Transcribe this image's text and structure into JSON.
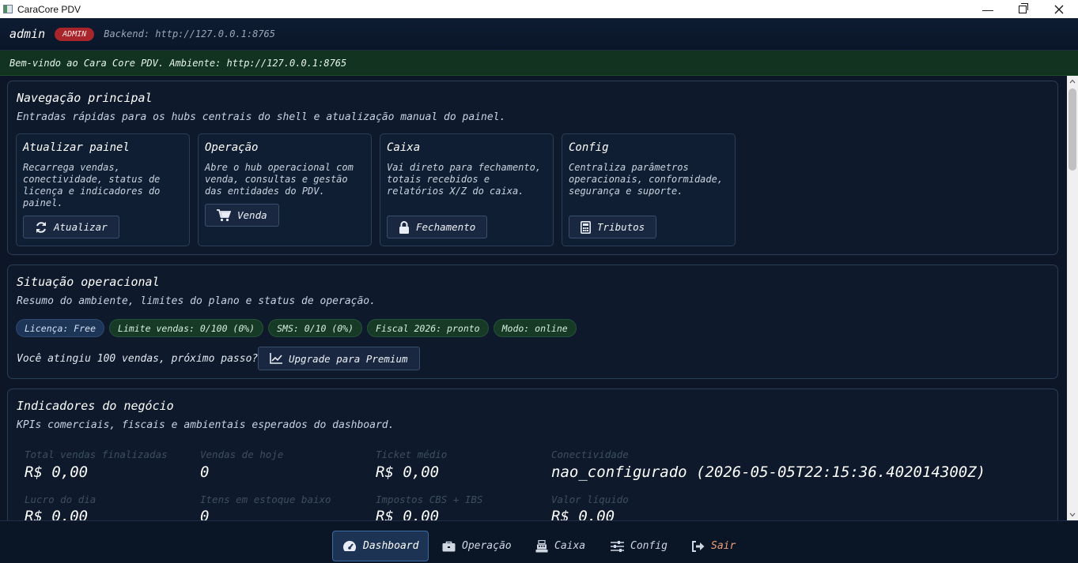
{
  "window": {
    "title": "CaraCore PDV",
    "minimize": "—"
  },
  "header": {
    "user": "admin",
    "role": "ADMIN",
    "backend": "Backend: http://127.0.0.1:8765"
  },
  "banner": "Bem-vindo ao Cara Core PDV. Ambiente: http://127.0.0.1:8765",
  "nav_section": {
    "title": "Navegação principal",
    "subtitle": "Entradas rápidas para os hubs centrais do shell e atualização manual do painel.",
    "hubs": [
      {
        "title": "Atualizar painel",
        "desc": "Recarrega vendas, conectividade, status de licença e indicadores do painel.",
        "button": "Atualizar",
        "icon": "refresh-icon"
      },
      {
        "title": "Operação",
        "desc": "Abre o hub operacional com venda, consultas e gestão das entidades do PDV.",
        "button": "Venda",
        "icon": "cart-icon"
      },
      {
        "title": "Caixa",
        "desc": "Vai direto para fechamento, totais recebidos e relatórios X/Z do caixa.",
        "button": "Fechamento",
        "icon": "lock-icon"
      },
      {
        "title": "Config",
        "desc": "Centraliza parâmetros operacionais, conformidade, segurança e suporte.",
        "button": "Tributos",
        "icon": "calculator-icon"
      }
    ]
  },
  "status_section": {
    "title": "Situação operacional",
    "subtitle": "Resumo do ambiente, limites do plano e status de operação.",
    "chips": [
      "Licença: Free",
      "Limite vendas: 0/100 (0%)",
      "SMS: 0/10 (0%)",
      "Fiscal 2026: pronto",
      "Modo: online"
    ],
    "upgrade_prompt": "Você atingiu 100 vendas, próximo passo?",
    "upgrade_button": "Upgrade para Premium"
  },
  "kpi_section": {
    "title": "Indicadores do negócio",
    "subtitle": "KPIs comerciais, fiscais e ambientais esperados do dashboard.",
    "kpis": [
      {
        "label": "Total vendas finalizadas",
        "value": "R$ 0,00"
      },
      {
        "label": "Vendas de hoje",
        "value": "0"
      },
      {
        "label": "Ticket médio",
        "value": "R$ 0,00"
      },
      {
        "label": "Conectividade",
        "value": "nao_configurado (2026-05-05T22:15:36.402014300Z)"
      },
      {
        "label": "Lucro do dia",
        "value": "R$ 0,00"
      },
      {
        "label": "Itens em estoque baixo",
        "value": "0"
      },
      {
        "label": "Impostos CBS + IBS",
        "value": "R$ 0,00"
      },
      {
        "label": "Valor líquido",
        "value": "R$ 0,00"
      }
    ]
  },
  "bottom_nav": [
    {
      "label": "Dashboard",
      "icon": "gauge-icon",
      "active": true
    },
    {
      "label": "Operação",
      "icon": "briefcase-icon"
    },
    {
      "label": "Caixa",
      "icon": "cash-register-icon"
    },
    {
      "label": "Config",
      "icon": "sliders-icon"
    },
    {
      "label": "Sair",
      "icon": "logout-icon"
    }
  ],
  "colors": {
    "accent": "#3c6aa3",
    "admin_badge": "#a8262b",
    "banner_bg": "#11331f",
    "exit": "#f0a07a"
  }
}
